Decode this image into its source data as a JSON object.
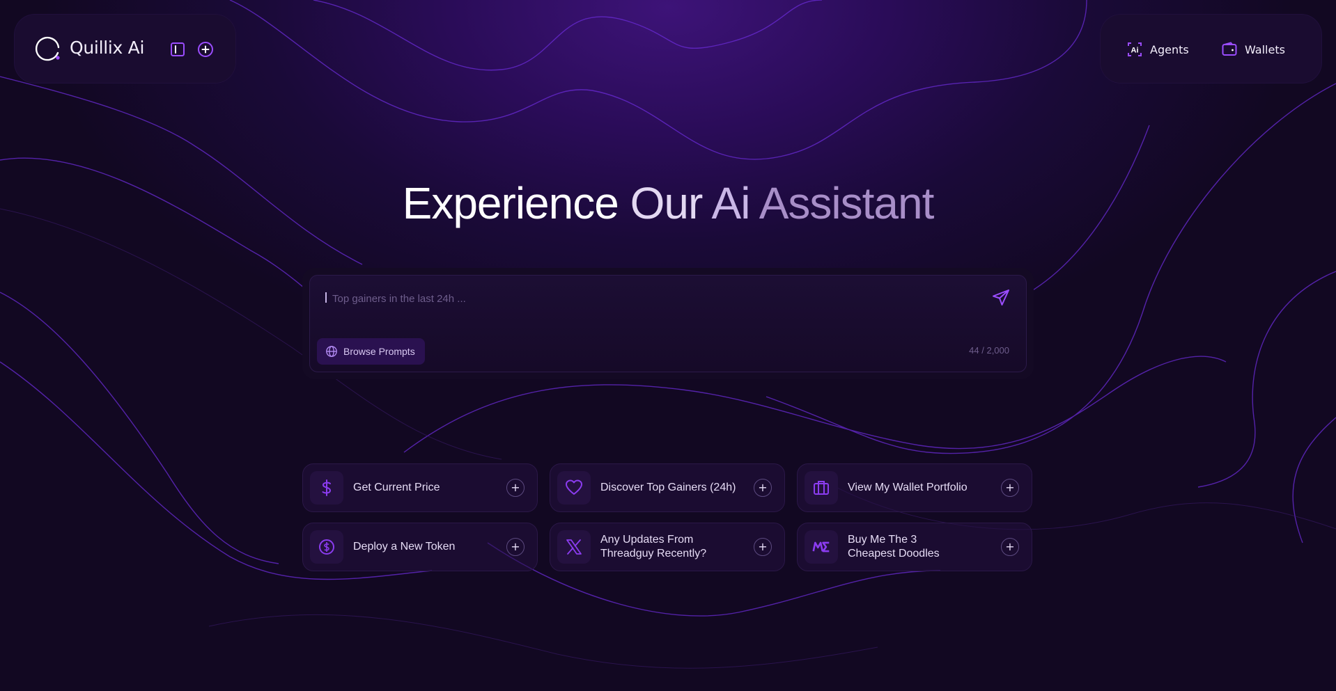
{
  "brand": {
    "name": "Quillix Ai"
  },
  "nav": {
    "agents_label": "Agents",
    "wallets_label": "Wallets"
  },
  "hero": {
    "word1": "Experience",
    "word2": "Our",
    "word3": "Ai",
    "word4": "Assistant"
  },
  "chat": {
    "placeholder": "Top gainers in the last 24h ...",
    "browse_label": "Browse Prompts",
    "counter": "44 / 2,000"
  },
  "suggestions": [
    {
      "label": "Get Current Price",
      "icon": "dollar-icon"
    },
    {
      "label": "Discover Top Gainers (24h)",
      "icon": "heart-icon"
    },
    {
      "label": "View My Wallet Portfolio",
      "icon": "briefcase-icon"
    },
    {
      "label": "Deploy a New Token",
      "icon": "coin-icon"
    },
    {
      "label": "Any Updates From Threadguy Recently?",
      "icon": "x-logo-icon"
    },
    {
      "label": "Buy Me The 3 Cheapest Doodles",
      "icon": "magic-eden-icon"
    }
  ],
  "colors": {
    "accent": "#8b3cf0",
    "background": "#120822",
    "panel": "#1a0c30"
  }
}
